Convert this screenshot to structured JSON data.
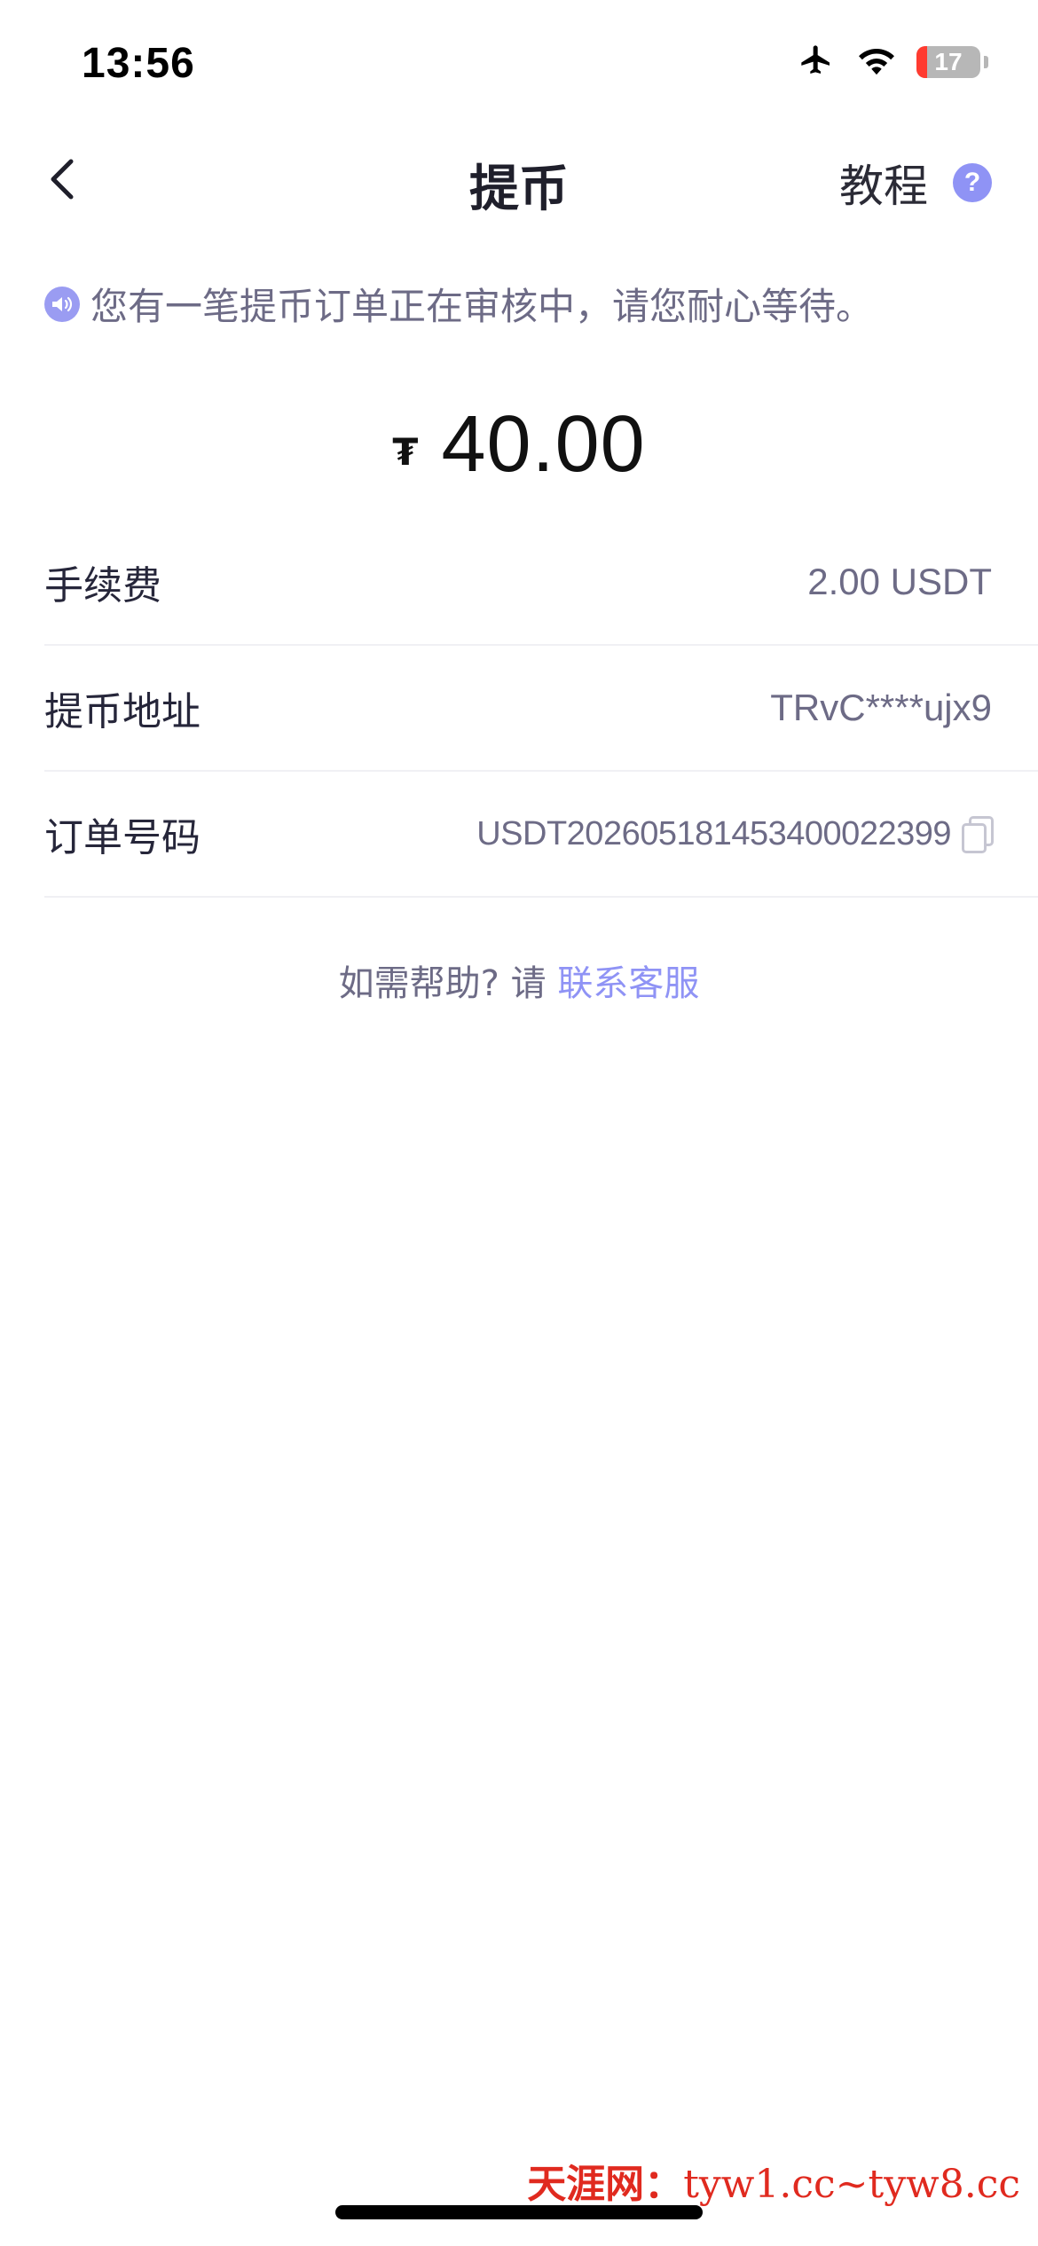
{
  "status_bar": {
    "time": "13:56",
    "battery_level": "17",
    "battery_fraction": 0.17,
    "icons": [
      "airplane-icon",
      "wifi-icon",
      "battery-icon"
    ]
  },
  "nav": {
    "title": "提币",
    "tutorial_label": "教程",
    "help_symbol": "?",
    "back_icon": "chevron-left-icon"
  },
  "notice": {
    "icon": "speaker-icon",
    "text": "您有一笔提币订单正在审核中，请您耐心等待。"
  },
  "amount": {
    "currency_symbol": "₮",
    "value": "40.00"
  },
  "details": {
    "fee_label": "手续费",
    "fee_value": "2.00 USDT",
    "address_label": "提币地址",
    "address_value": "TRvC****ujx9",
    "order_label": "订单号码",
    "order_value": "USDT20260518145340002239​9"
  },
  "help": {
    "prefix": "如需帮助? 请 ",
    "link_text": "联系客服"
  },
  "watermark": {
    "brand": "天涯网：",
    "text": "tyw1.cc~tyw8.cc"
  },
  "colors": {
    "accent": "#8f93f5",
    "muted_text": "#6d6b86",
    "battery_low": "#ff3b30",
    "watermark": "#e02a1f"
  }
}
